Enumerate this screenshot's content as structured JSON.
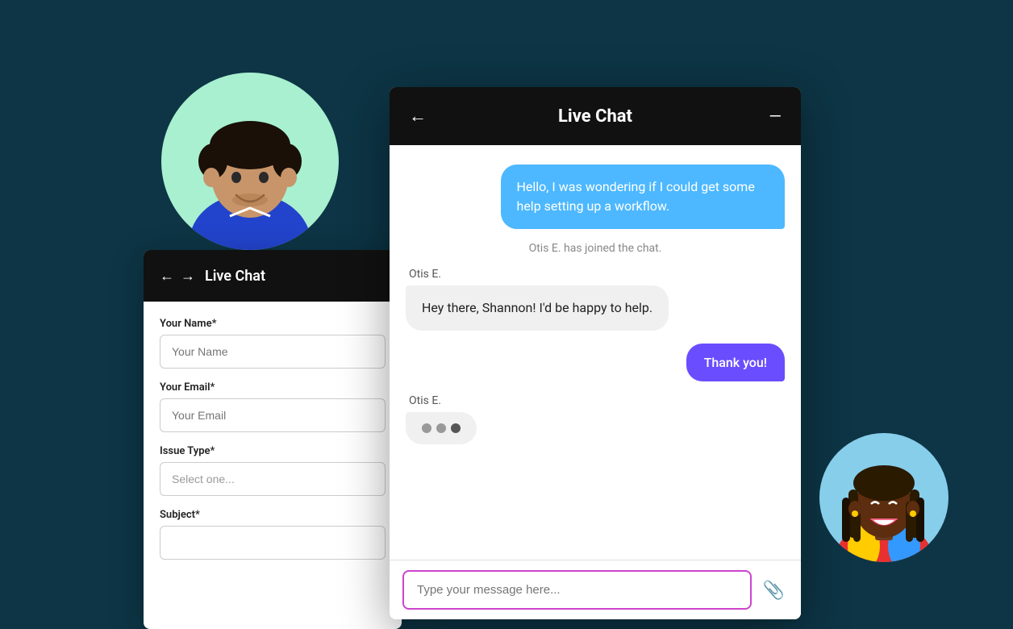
{
  "background_color": "#0d3545",
  "avatar_top": {
    "bg_color": "#a8f0d0",
    "description": "male person with dark curly hair"
  },
  "avatar_bottom": {
    "bg_color": "#87ceeb",
    "description": "female person smiling with braids"
  },
  "form_panel": {
    "header": {
      "title": "Live Chat",
      "back_label": "←",
      "forward_label": "→"
    },
    "fields": [
      {
        "label": "Your Name*",
        "placeholder": "Your Name",
        "type": "text"
      },
      {
        "label": "Your Email*",
        "placeholder": "Your Email",
        "type": "text"
      },
      {
        "label": "Issue Type*",
        "placeholder": "Select one...",
        "type": "select"
      },
      {
        "label": "Subject*",
        "placeholder": "",
        "type": "text"
      }
    ]
  },
  "chat_panel": {
    "header": {
      "title": "Live Chat",
      "back_arrow": "←",
      "minimize": "—"
    },
    "messages": [
      {
        "type": "user",
        "text": "Hello, I was wondering if I could get some help setting up a workflow."
      },
      {
        "type": "system",
        "text": "Otis E. has joined the chat."
      },
      {
        "type": "agent",
        "sender": "Otis E.",
        "text": "Hey there, Shannon! I'd be happy to help."
      },
      {
        "type": "user_reply",
        "text": "Thank you!"
      },
      {
        "type": "agent_typing",
        "sender": "Otis E."
      }
    ],
    "input_placeholder": "Type your message here...",
    "attach_icon": "📎"
  }
}
